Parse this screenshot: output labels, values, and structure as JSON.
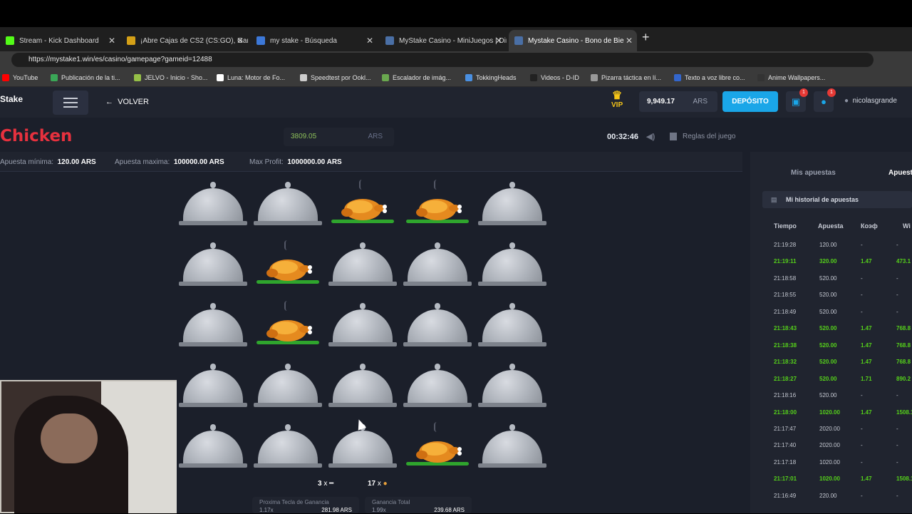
{
  "browser": {
    "tabs": [
      {
        "label": "Stream - Kick Dashboard",
        "fav": "#53fc18"
      },
      {
        "label": "¡Abre Cajas de CS2 (CS:GO), Gana",
        "fav": "#d4a017"
      },
      {
        "label": "my stake - Búsqueda",
        "fav": "#3c78d8"
      },
      {
        "label": "MyStake Casino - MiniJuegos | Dir",
        "fav": "#4a6fa5"
      },
      {
        "label": "Mystake Casino - Bono de Bie",
        "fav": "#4a6fa5"
      }
    ],
    "url": "https://mystake1.win/es/casino/gamepage?gameid=12488",
    "bookmarks": [
      {
        "label": "YouTube",
        "color": "#ff0000"
      },
      {
        "label": "Publicación de la ti...",
        "color": "#3aa757"
      },
      {
        "label": "JELVO - Inicio - Sho...",
        "color": "#95bf47"
      },
      {
        "label": "Luna: Motor de Fo...",
        "color": "#ffffff"
      },
      {
        "label": "Speedtest por Ookl...",
        "color": "#cccccc"
      },
      {
        "label": "Escalador de imág...",
        "color": "#6aa84f"
      },
      {
        "label": "TokkingHeads",
        "color": "#4a90e2"
      },
      {
        "label": "Videos - D-ID",
        "color": "#222222"
      },
      {
        "label": "Pizarra táctica en lí...",
        "color": "#999999"
      },
      {
        "label": "Texto a voz libre co...",
        "color": "#3366cc"
      },
      {
        "label": "Anime Wallpapers...",
        "color": "#333333"
      }
    ]
  },
  "header": {
    "logo": "Stake",
    "volver": "VOLVER",
    "vip": "VIP",
    "balance": "9,949.17",
    "currency": "ARS",
    "deposit": "DEPÓSITO",
    "gift_badge": "1",
    "bell_badge": "1",
    "username": "nicolasgrande"
  },
  "game": {
    "title": "Chicken",
    "bet_amount": "3809.05",
    "bet_currency": "ARS",
    "timer": "00:32:46",
    "rules": "Reglas del juego",
    "min_label": "Apuesta mínima:",
    "min_value": "120.00 ARS",
    "max_label": "Apuesta maxima:",
    "max_value": "100000.00 ARS",
    "profit_label": "Max Profit:",
    "profit_value": "1000000.00 ARS",
    "grid": [
      [
        "dome",
        "dome",
        "chicken",
        "chicken",
        "dome"
      ],
      [
        "dome",
        "chicken",
        "dome",
        "dome",
        "dome"
      ],
      [
        "dome",
        "chicken",
        "dome",
        "dome",
        "dome"
      ],
      [
        "dome",
        "dome",
        "dome",
        "dome",
        "dome"
      ],
      [
        "dome",
        "dome",
        "dome",
        "chicken",
        "dome"
      ]
    ],
    "bones_count": "3",
    "chicken_count": "17",
    "next_label": "Proxima Tecla de Ganancia",
    "next_mult": "1.17x",
    "next_value": "281.98 ARS",
    "total_label": "Ganancia Total",
    "total_mult": "1.99x",
    "total_value": "239.68 ARS"
  },
  "side": {
    "tab1": "Mis apuestas",
    "tab2": "Apuest",
    "history": "Mi historial de apuestas",
    "cols": [
      "Tiempo",
      "Apuesta",
      "Коэф",
      "Wi"
    ],
    "rows": [
      {
        "t": "21:19:28",
        "a": "120.00",
        "k": "-",
        "w": "-",
        "win": false
      },
      {
        "t": "21:19:11",
        "a": "320.00",
        "k": "1.47",
        "w": "473.1",
        "win": true
      },
      {
        "t": "21:18:58",
        "a": "520.00",
        "k": "-",
        "w": "-",
        "win": false
      },
      {
        "t": "21:18:55",
        "a": "520.00",
        "k": "-",
        "w": "-",
        "win": false
      },
      {
        "t": "21:18:49",
        "a": "520.00",
        "k": "-",
        "w": "-",
        "win": false
      },
      {
        "t": "21:18:43",
        "a": "520.00",
        "k": "1.47",
        "w": "768.8",
        "win": true
      },
      {
        "t": "21:18:38",
        "a": "520.00",
        "k": "1.47",
        "w": "768.8",
        "win": true
      },
      {
        "t": "21:18:32",
        "a": "520.00",
        "k": "1.47",
        "w": "768.8",
        "win": true
      },
      {
        "t": "21:18:27",
        "a": "520.00",
        "k": "1.71",
        "w": "890.2",
        "win": true
      },
      {
        "t": "21:18:16",
        "a": "520.00",
        "k": "-",
        "w": "-",
        "win": false
      },
      {
        "t": "21:18:00",
        "a": "1020.00",
        "k": "1.47",
        "w": "1508.1",
        "win": true
      },
      {
        "t": "21:17:47",
        "a": "2020.00",
        "k": "-",
        "w": "-",
        "win": false
      },
      {
        "t": "21:17:40",
        "a": "2020.00",
        "k": "-",
        "w": "-",
        "win": false
      },
      {
        "t": "21:17:18",
        "a": "1020.00",
        "k": "-",
        "w": "-",
        "win": false
      },
      {
        "t": "21:17:01",
        "a": "1020.00",
        "k": "1.47",
        "w": "1508.1",
        "win": true
      },
      {
        "t": "21:16:49",
        "a": "220.00",
        "k": "-",
        "w": "-",
        "win": false
      }
    ]
  }
}
